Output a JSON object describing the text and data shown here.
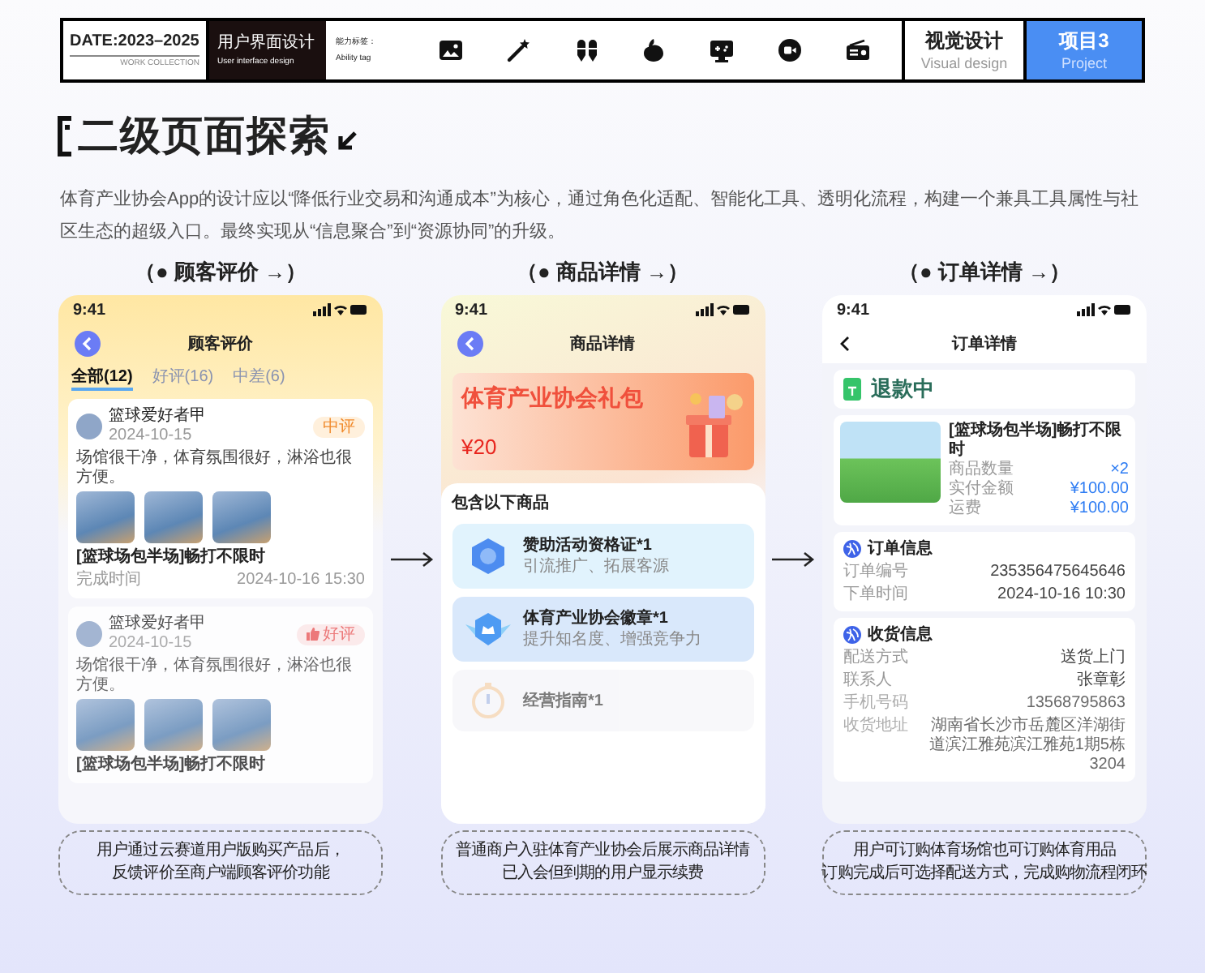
{
  "header": {
    "date": "DATE:2023–2025",
    "collection": "WORK COLLECTION",
    "category": {
      "title": "用户界面设计",
      "subtitle": "User interface design"
    },
    "ability": {
      "label": "能力标签：",
      "sublabel": "Ability tag"
    },
    "visual": {
      "title": "视觉设计",
      "subtitle": "Visual design"
    },
    "project": {
      "title": "项目3",
      "subtitle": "Project"
    }
  },
  "section_title": "二级页面探索",
  "intro": "体育产业协会App的设计应以“降低行业交易和沟通成本”为核心，通过角色化适配、智能化工具、透明化流程，构建一个兼具工具属性与社区生态的超级入口。最终实现从“信息聚合”到“资源协同”的升级。",
  "screens": [
    {
      "kind": "reviews",
      "heading": "（● 顾客评价 →）",
      "time": "9:41",
      "title": "顾客评价",
      "caption": [
        "用户通过云赛道用户版购买产品后，",
        "反馈评价至商户端顾客评价功能"
      ],
      "tabs": [
        {
          "label": "全部(12)",
          "selected": true
        },
        {
          "label": "好评(16)",
          "selected": false
        },
        {
          "label": "中差(6)",
          "selected": false
        }
      ],
      "reviews": [
        {
          "user": "篮球爱好者甲",
          "date": "2024-10-15",
          "badge": {
            "kind": "neutral",
            "label": "中评"
          },
          "comment": "场馆很干净，体育氛围很好，淋浴也很方便。",
          "product": "[篮球场包半场]畅打不限时",
          "completed_label": "完成时间",
          "completed_time": "2024-10-16 15:30"
        },
        {
          "user": "篮球爱好者甲",
          "date": "2024-10-15",
          "badge": {
            "kind": "good",
            "label": "好评"
          },
          "comment": "场馆很干净，体育氛围很好，淋浴也很方便。",
          "product": "[篮球场包半场]畅打不限时"
        }
      ]
    },
    {
      "kind": "product",
      "heading": "（● 商品详情 →）",
      "time": "9:41",
      "title": "商品详情",
      "caption": [
        "普通商户入驻体育产业协会后展示商品详情",
        "已入会但到期的用户显示续费"
      ],
      "banner_title": "体育产业协会礼包",
      "price": "¥20",
      "section": "包含以下商品",
      "items": [
        {
          "name": "赞助活动资格证*1",
          "desc": "引流推广、拓展客源"
        },
        {
          "name": "体育产业协会徽章*1",
          "desc": "提升知名度、增强竞争力"
        },
        {
          "name": "经营指南*1"
        }
      ]
    },
    {
      "kind": "order",
      "heading": "（● 订单详情 →）",
      "time": "9:41",
      "title": "订单详情",
      "caption": [
        "用户可订购体育场馆也可订购体育用品",
        "订购完成后可选择配送方式，完成购物流程闭环"
      ],
      "status": "退款中",
      "product": {
        "name": "[篮球场包半场]畅打不限时",
        "rows": [
          {
            "label": "商品数量",
            "value": "×2"
          },
          {
            "label": "实付金额",
            "value": "¥100.00"
          },
          {
            "label": "运费",
            "value": "¥100.00"
          }
        ]
      },
      "sections": [
        {
          "title": "订单信息",
          "rows": [
            {
              "label": "订单编号",
              "value": "235356475645646"
            },
            {
              "label": "下单时间",
              "value": "2024-10-16  10:30"
            }
          ]
        },
        {
          "title": "收货信息",
          "rows": [
            {
              "label": "配送方式",
              "value": "送货上门"
            },
            {
              "label": "联系人",
              "value": "张章彰"
            },
            {
              "label": "手机号码",
              "value": "13568795863"
            },
            {
              "label": "收货地址",
              "value": "湖南省长沙市岳麓区洋湖街道滨江雅苑滨江雅苑1期5栋3204"
            }
          ]
        }
      ]
    }
  ]
}
